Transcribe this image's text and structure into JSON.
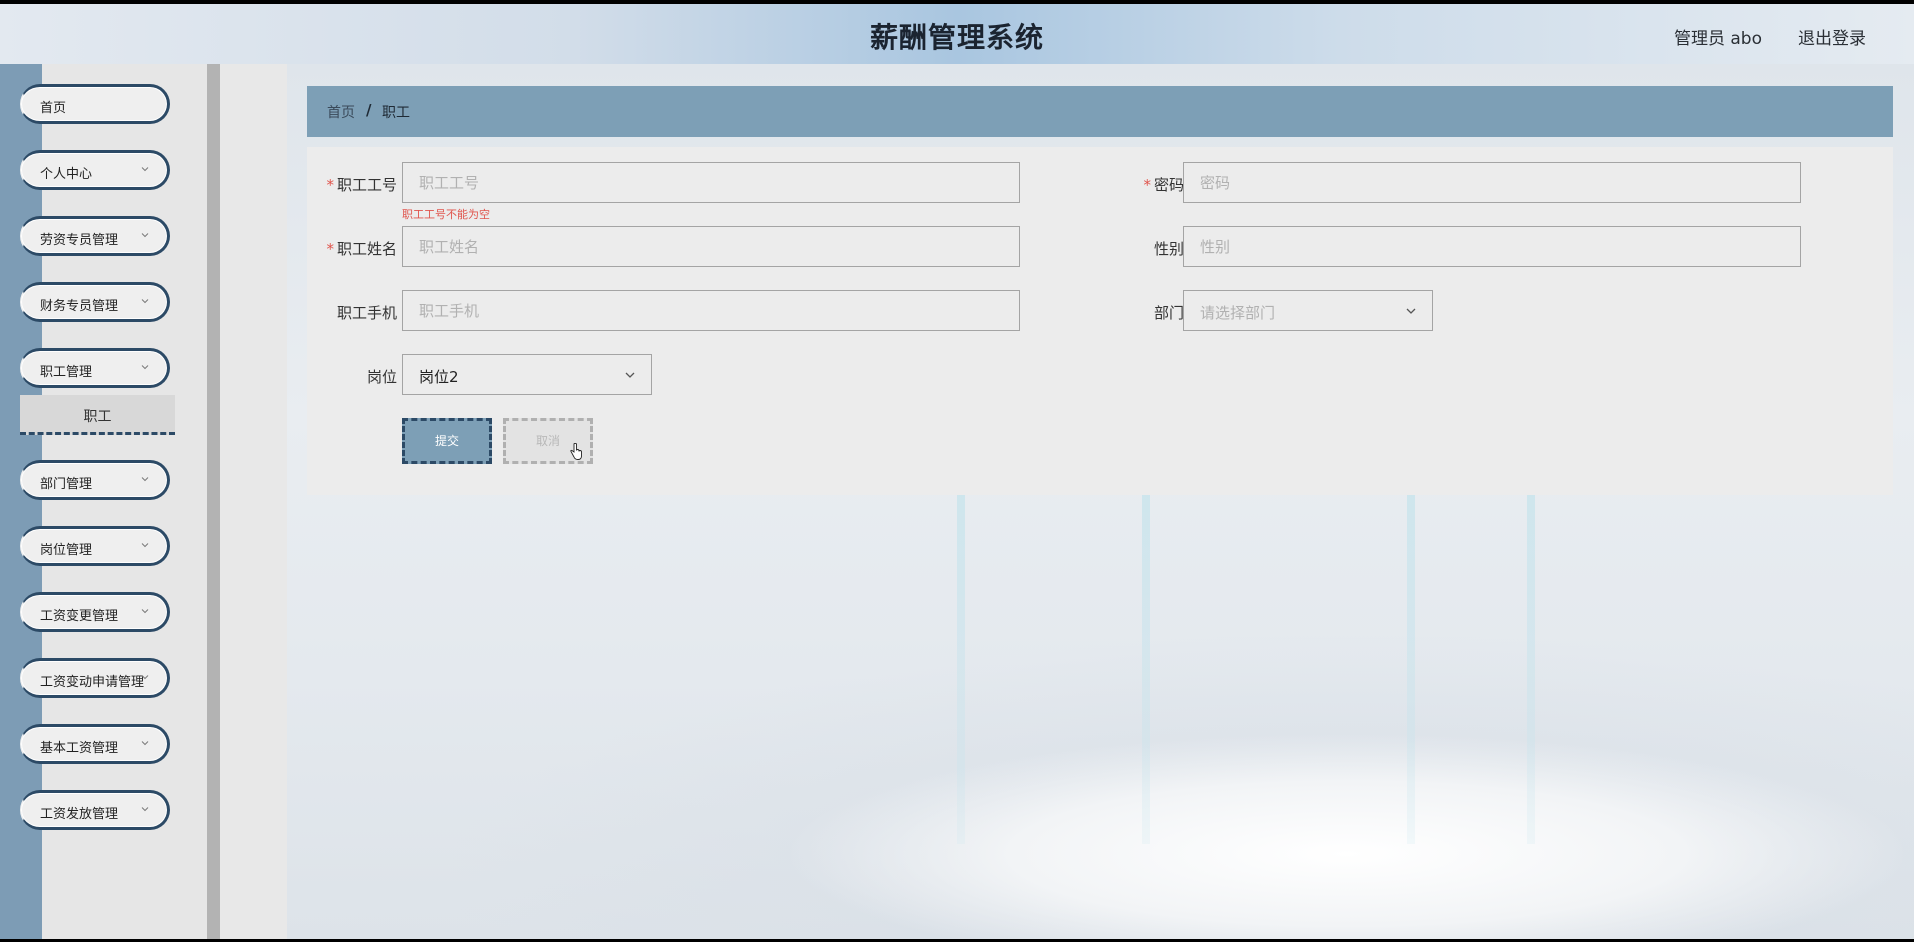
{
  "header": {
    "title": "薪酬管理系统",
    "user": "管理员 abo",
    "logout": "退出登录"
  },
  "sidebar": {
    "items": [
      {
        "label": "首页",
        "has_submenu": false
      },
      {
        "label": "个人中心",
        "has_submenu": true
      },
      {
        "label": "劳资专员管理",
        "has_submenu": true
      },
      {
        "label": "财务专员管理",
        "has_submenu": true
      },
      {
        "label": "职工管理",
        "has_submenu": true
      },
      {
        "label": "部门管理",
        "has_submenu": true
      },
      {
        "label": "岗位管理",
        "has_submenu": true
      },
      {
        "label": "工资变更管理",
        "has_submenu": true
      },
      {
        "label": "工资变动申请管理",
        "has_submenu": true
      },
      {
        "label": "基本工资管理",
        "has_submenu": true
      },
      {
        "label": "工资发放管理",
        "has_submenu": true
      }
    ],
    "open_submenu": {
      "parent": "职工管理",
      "items": [
        "职工"
      ]
    }
  },
  "breadcrumb": {
    "home": "首页",
    "separator": "/",
    "current": "职工"
  },
  "form": {
    "employee_no": {
      "label": "职工工号",
      "required": true,
      "value": "",
      "placeholder": "职工工号",
      "error": "职工工号不能为空"
    },
    "password": {
      "label": "密码",
      "required": true,
      "value": "",
      "placeholder": "密码"
    },
    "employee_name": {
      "label": "职工姓名",
      "required": true,
      "value": "",
      "placeholder": "职工姓名"
    },
    "gender": {
      "label": "性别",
      "required": false,
      "value": "",
      "placeholder": "性别"
    },
    "phone": {
      "label": "职工手机",
      "required": false,
      "value": "",
      "placeholder": "职工手机"
    },
    "department": {
      "label": "部门",
      "required": false,
      "value": "",
      "placeholder": "请选择部门"
    },
    "position": {
      "label": "岗位",
      "required": false,
      "value": "岗位2"
    },
    "submit_label": "提交",
    "cancel_label": "取消"
  },
  "colors": {
    "accent": "#7d9fb6",
    "menu_border": "#2c4a66",
    "error": "#e0554d"
  }
}
